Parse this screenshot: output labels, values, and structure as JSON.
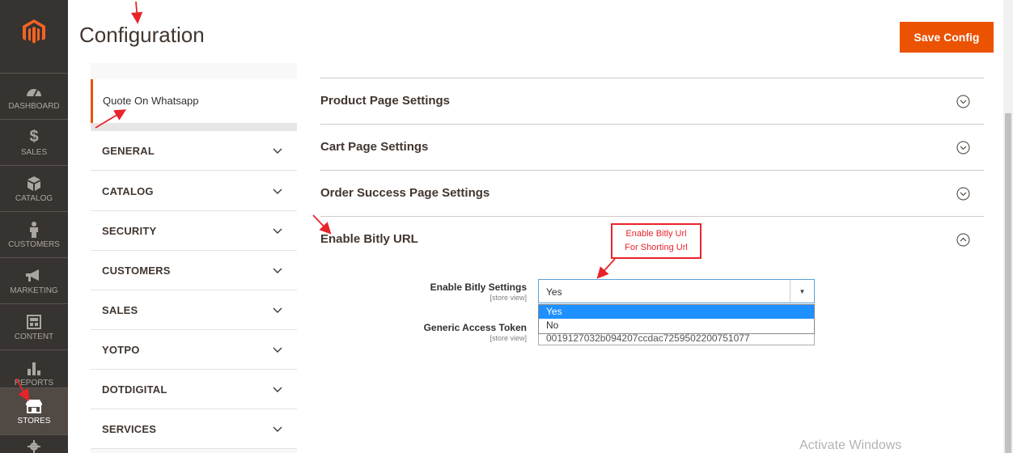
{
  "header": {
    "title": "Configuration",
    "save_label": "Save Config"
  },
  "nav": {
    "items": [
      {
        "icon": "dashboard-icon",
        "label": "DASHBOARD"
      },
      {
        "icon": "dollar-icon",
        "label": "SALES"
      },
      {
        "icon": "catalog-icon",
        "label": "CATALOG"
      },
      {
        "icon": "person-icon",
        "label": "CUSTOMERS"
      },
      {
        "icon": "megaphone-icon",
        "label": "MARKETING"
      },
      {
        "icon": "content-icon",
        "label": "CONTENT"
      },
      {
        "icon": "bar-chart-icon",
        "label": "REPORTS"
      },
      {
        "icon": "store-icon",
        "label": "STORES"
      }
    ],
    "active": "STORES"
  },
  "config_tabs": {
    "active_item": "Quote On Whatsapp",
    "sections": [
      "GENERAL",
      "CATALOG",
      "SECURITY",
      "CUSTOMERS",
      "SALES",
      "YOTPO",
      "DOTDIGITAL",
      "SERVICES"
    ]
  },
  "content": {
    "sections": [
      {
        "title": "Product Page Settings",
        "state": "collapsed"
      },
      {
        "title": "Cart Page Settings",
        "state": "collapsed"
      },
      {
        "title": "Order Success Page Settings",
        "state": "collapsed"
      },
      {
        "title": "Enable Bitly URL",
        "state": "expanded"
      }
    ],
    "fields": {
      "bitly": {
        "label": "Enable Bitly Settings",
        "scope": "[store view]",
        "value": "Yes",
        "options": [
          "Yes",
          "No"
        ],
        "selected": "Yes"
      },
      "token": {
        "label": "Generic Access Token",
        "scope": "[store view]",
        "value": "0019127032b094207ccdac7259502200751077"
      }
    }
  },
  "annotation": {
    "line1": "Enable Bitly Url",
    "line2": "For Shorting Url",
    "color": "#e8242b"
  },
  "watermark": "Activate Windows",
  "colors": {
    "accent": "#eb5202",
    "nav_bg": "#373330",
    "select_highlight": "#1e90ff"
  }
}
